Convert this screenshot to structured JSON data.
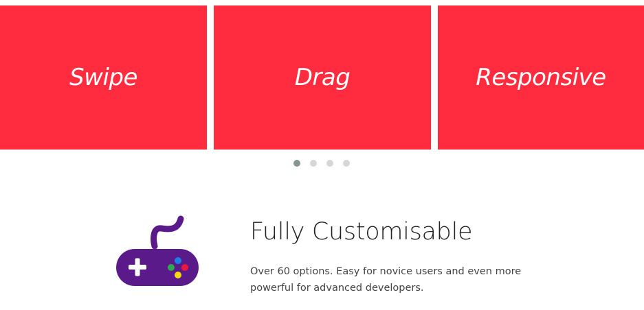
{
  "carousel": {
    "slides": [
      {
        "label": "Swipe"
      },
      {
        "label": "Drag"
      },
      {
        "label": "Responsive"
      }
    ],
    "dots": 4,
    "active_dot": 1,
    "slide_color": "#ff2c40",
    "dot_color": "#d6d6d6",
    "dot_active_color": "#869791"
  },
  "feature": {
    "icon": "gamepad-icon",
    "title": "Fully Customisable",
    "description": "Over 60 options. Easy for novice users and even more powerful for advanced developers.",
    "icon_color": "#5b1a8a"
  }
}
